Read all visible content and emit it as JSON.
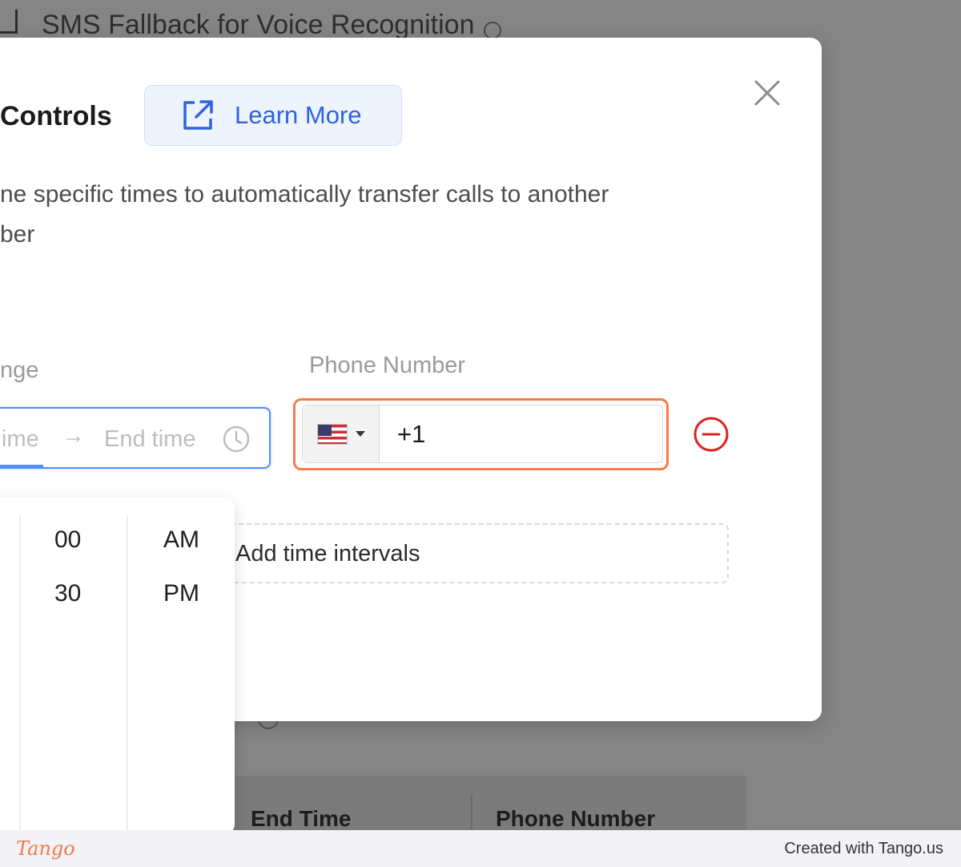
{
  "background": {
    "page_title": "SMS Fallback for Voice Recognition",
    "table_headers": [
      "End Time",
      "Phone Number"
    ]
  },
  "modal": {
    "title": "Controls",
    "learn_more_label": "Learn More",
    "description": "ne specific times to automatically transfer calls to another\nber",
    "time_range_label": "nge",
    "phone_label": "Phone Number",
    "time_start_placeholder": "ime",
    "time_arrow": "→",
    "time_end_placeholder": "End time",
    "phone_country": "US",
    "phone_value": "+1",
    "add_intervals_label": "Add time intervals"
  },
  "time_picker": {
    "minutes": [
      "00",
      "30"
    ],
    "meridiem": [
      "AM",
      "PM"
    ]
  },
  "footer": {
    "logo_text": "Tango",
    "created_with": "Created with Tango.us"
  },
  "colors": {
    "accent_blue": "#4f8ff7",
    "link_blue": "#2f63dd",
    "highlight_orange": "#f47c4a",
    "danger_red": "#e02020",
    "overlay": "#858585"
  }
}
